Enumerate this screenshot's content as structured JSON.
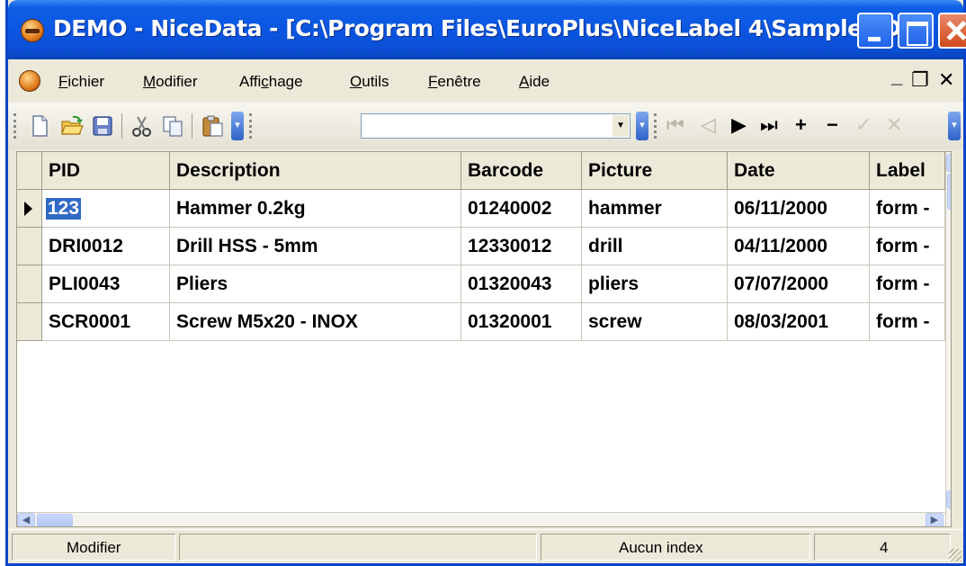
{
  "window": {
    "title": "DEMO - NiceData - [C:\\Program Files\\EuroPlus\\NiceLabel 4\\Samples\\D..."
  },
  "menu": [
    {
      "label": "Fichier",
      "accel": "F",
      "rest": "ichier"
    },
    {
      "label": "Modifier",
      "accel": "M",
      "rest": "odifier"
    },
    {
      "label": "Affichage",
      "pre": "Affi",
      "accel": "c",
      "rest": "hage"
    },
    {
      "label": "Outils",
      "accel": "O",
      "rest": "utils"
    },
    {
      "label": "Fenêtre",
      "accel": "F",
      "rest": "enêtre"
    },
    {
      "label": "Aide",
      "accel": "A",
      "rest": "ide"
    }
  ],
  "toolbar": {
    "combo_value": "",
    "icons": [
      "new-icon",
      "open-icon",
      "save-icon",
      "cut-icon",
      "copy-icon",
      "paste-icon",
      "first-record-icon",
      "prior-record-icon",
      "next-record-icon",
      "last-record-icon",
      "insert-record-icon",
      "delete-record-icon",
      "post-edit-icon",
      "cancel-edit-icon"
    ]
  },
  "grid": {
    "columns": [
      "PID",
      "Description",
      "Barcode",
      "Picture",
      "Date",
      "Label"
    ],
    "rows": [
      [
        "123",
        "Hammer 0.2kg",
        "01240002",
        "hammer",
        "06/11/2000",
        "form -"
      ],
      [
        "DRI0012",
        "Drill HSS - 5mm",
        "12330012",
        "drill",
        "04/11/2000",
        "form -"
      ],
      [
        "PLI0043",
        "Pliers",
        "01320043",
        "pliers",
        "07/07/2000",
        "form -"
      ],
      [
        "SCR0001",
        "Screw M5x20 - INOX",
        "01320001",
        "screw",
        "08/03/2001",
        "form -"
      ]
    ],
    "current_row": 0
  },
  "status": {
    "mode": "Modifier",
    "middle": "",
    "index": "Aucun index",
    "count": "4"
  },
  "colors": {
    "title_bar": "#0a55e0",
    "selection": "#316ac5",
    "chrome": "#ece9d8"
  }
}
